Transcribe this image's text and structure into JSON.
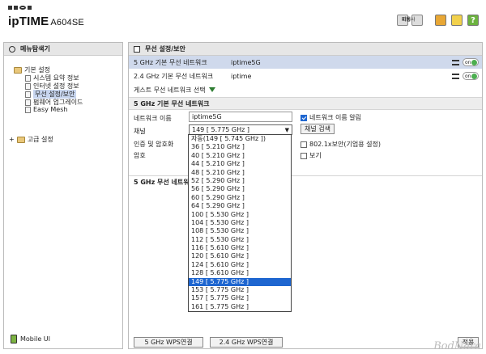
{
  "header": {
    "brand_prefix": "ip",
    "brand_name": "TIME",
    "model": "A604SE",
    "buttons": [
      {
        "label": "마법사",
        "color": "#e8a735"
      },
      {
        "label": "기능",
        "color": "#f2d14c"
      },
      {
        "label": "도움",
        "color": "#6cb33f"
      }
    ]
  },
  "sidebar": {
    "title": "메뉴탐색기",
    "groups": [
      {
        "label": "기본 설정",
        "items": [
          {
            "label": "시스템 요약 정보"
          },
          {
            "label": "인터넷 설정 정보"
          },
          {
            "label": "무선 설정/보안"
          },
          {
            "label": "펌웨어 업그레이드"
          },
          {
            "label": "Easy Mesh"
          }
        ]
      },
      {
        "label": "고급 설정",
        "items": []
      }
    ],
    "mobile_label": "Mobile UI"
  },
  "main": {
    "title": "무선 설정/보안",
    "networks": [
      {
        "label": "5 GHz 기본 무선 네트워크",
        "ssid": "iptime5G",
        "toggle": "on"
      },
      {
        "label": "2.4 GHz 기본 무선 네트워크",
        "ssid": "iptime",
        "toggle": "on"
      }
    ],
    "guest_label": "게스트 무선 네트워크 선택",
    "section_title": "5 GHz 기본 무선 네트워크",
    "form": {
      "network_name_label": "네트워크 이름",
      "network_name_value": "iptime5G",
      "broadcast_label": "네트워크 이름 알림",
      "channel_label": "채널",
      "channel_value": "149 [ 5.775 GHz ]",
      "channel_search_button": "채널 검색",
      "auth_label": "인증 및 암호화",
      "dot1x_label": "802.1x보안(기업용 설정)",
      "password_label": "암호",
      "show_label": "보기"
    },
    "section2_title_visible": "5 GHz 무선 네트워",
    "wps_buttons": [
      "5 GHz WPS연결",
      "2.4 GHz WPS연결"
    ],
    "apply_button": "적용"
  },
  "channel_options": [
    "자동(149 [ 5.745 GHz ])",
    "36 [ 5.210 GHz ]",
    "40 [ 5.210 GHz ]",
    "44 [ 5.210 GHz ]",
    "48 [ 5.210 GHz ]",
    "52 [ 5.290 GHz ]",
    "56 [ 5.290 GHz ]",
    "60 [ 5.290 GHz ]",
    "64 [ 5.290 GHz ]",
    "100 [ 5.530 GHz ]",
    "104 [ 5.530 GHz ]",
    "108 [ 5.530 GHz ]",
    "112 [ 5.530 GHz ]",
    "116 [ 5.610 GHz ]",
    "120 [ 5.610 GHz ]",
    "124 [ 5.610 GHz ]",
    "128 [ 5.610 GHz ]",
    "149 [ 5.775 GHz ]",
    "153 [ 5.775 GHz ]",
    "157 [ 5.775 GHz ]",
    "161 [ 5.775 GHz ]"
  ],
  "selected_channel_index": 17,
  "watermark": "BodNara"
}
